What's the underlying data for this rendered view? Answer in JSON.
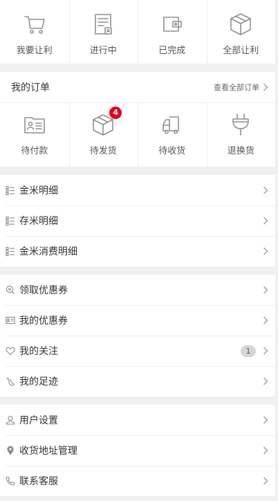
{
  "top_nav": {
    "items": [
      {
        "label": "我要让利",
        "icon": "cart-icon"
      },
      {
        "label": "进行中",
        "icon": "document-in-progress-icon"
      },
      {
        "label": "已完成",
        "icon": "wallet-icon"
      },
      {
        "label": "全部让利",
        "icon": "box-icon"
      }
    ]
  },
  "orders": {
    "title": "我的订单",
    "view_all": "查看全部订单",
    "status": [
      {
        "label": "待付款",
        "icon": "id-card-icon",
        "badge": ""
      },
      {
        "label": "待发货",
        "icon": "package-icon",
        "badge": "4"
      },
      {
        "label": "待收货",
        "icon": "truck-icon",
        "badge": ""
      },
      {
        "label": "退换货",
        "icon": "plug-icon",
        "badge": ""
      }
    ]
  },
  "group_details": {
    "items": [
      {
        "label": "金米明细"
      },
      {
        "label": "存米明细"
      },
      {
        "label": "金米消费明细"
      }
    ]
  },
  "group_coupons": {
    "items": [
      {
        "label": "领取优惠券",
        "icon": "search-coupon-icon"
      },
      {
        "label": "我的优惠券",
        "icon": "coupon-card-icon"
      },
      {
        "label": "我的关注",
        "icon": "heart-icon",
        "count": "1"
      },
      {
        "label": "我的足迹",
        "icon": "footprint-icon"
      }
    ]
  },
  "group_settings": {
    "items": [
      {
        "label": "用户设置",
        "icon": "user-icon"
      },
      {
        "label": "收货地址管理",
        "icon": "location-pin-icon"
      },
      {
        "label": "联系客服",
        "icon": "phone-icon"
      }
    ]
  },
  "colors": {
    "badge_red": "#e4001d",
    "icon_gray": "#8a8a8a",
    "background": "#f0f0f0"
  }
}
